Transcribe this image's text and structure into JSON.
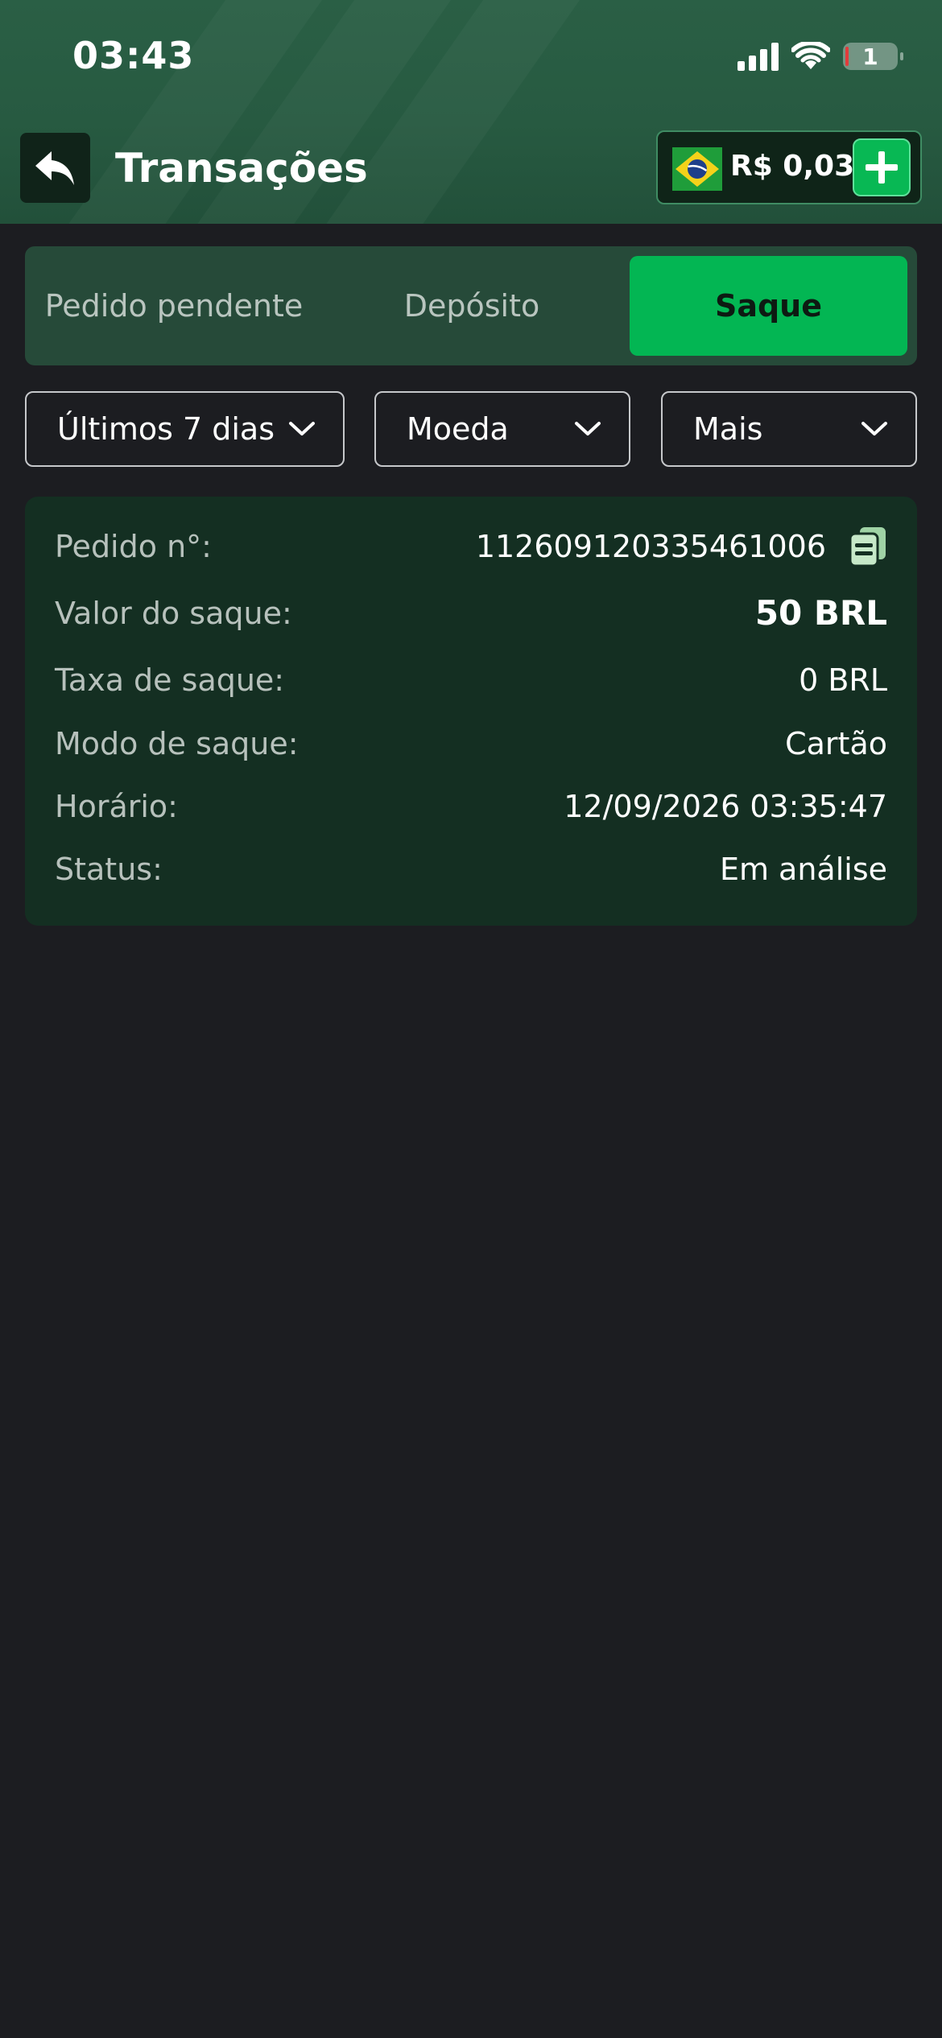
{
  "status_bar": {
    "time": "03:43",
    "battery_level": "1"
  },
  "header": {
    "title": "Transações",
    "balance": "R$ 0,03"
  },
  "tabs": [
    {
      "label": "Pedido pendente",
      "active": false
    },
    {
      "label": "Depósito",
      "active": false
    },
    {
      "label": "Saque",
      "active": true
    }
  ],
  "filters": {
    "period": "Últimos 7 dias",
    "currency": "Moeda",
    "more": "Mais"
  },
  "transaction": {
    "order_label": "Pedido n°:",
    "order_value": "112609120335461006",
    "amount_label": "Valor do saque:",
    "amount_value": "50 BRL",
    "fee_label": "Taxa de saque:",
    "fee_value": "0 BRL",
    "mode_label": "Modo de saque:",
    "mode_value": "Cartão",
    "time_label": "Horário:",
    "time_value": "12/09/2026 03:35:47",
    "status_label": "Status:",
    "status_value": "Em análise"
  },
  "colors": {
    "header_green": "#275a41",
    "accent_green": "#03b653",
    "card_bg": "#142f22",
    "page_bg": "#1c1d21"
  },
  "icons": [
    "back-arrow-icon",
    "wifi-icon",
    "signal-icon",
    "battery-icon",
    "brazil-flag-icon",
    "plus-icon",
    "chevron-down-icon",
    "copy-icon"
  ]
}
